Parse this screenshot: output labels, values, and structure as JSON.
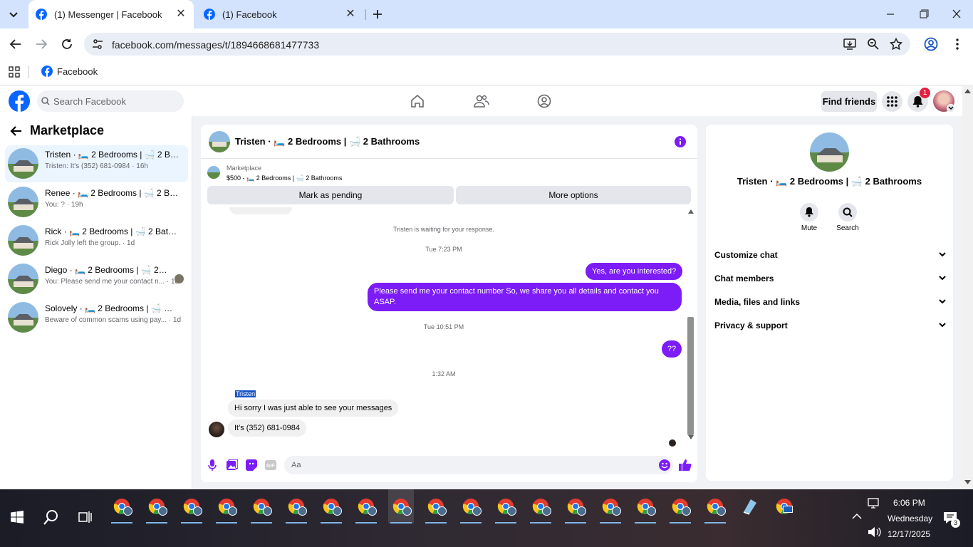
{
  "browser": {
    "tabs": [
      {
        "title": "(1) Messenger | Facebook",
        "active": true
      },
      {
        "title": "(1) Facebook",
        "active": false
      }
    ],
    "url": "facebook.com/messages/t/1894668681477733",
    "bookmark": "Facebook"
  },
  "header": {
    "search_placeholder": "Search Facebook",
    "find_friends": "Find friends",
    "notification_count": "1"
  },
  "sidebar": {
    "title": "Marketplace",
    "conversations": [
      {
        "name": "Tristen · 🛏️ 2 Bedrooms | 🛁 2 Bat...",
        "preview": "Tristen: It's (352) 681-0984 · 16h",
        "selected": true
      },
      {
        "name": "Renee · 🛏️ 2 Bedrooms | 🛁 2 Bath...",
        "preview": "You: ? · 19h"
      },
      {
        "name": "Rick · 🛏️ 2 Bedrooms | 🛁 2 Bathr...",
        "preview": "Rick Jolly left the group. · 1d"
      },
      {
        "name": "Diego · 🛏️ 2 Bedrooms | 🛁 2 B...",
        "preview": "You: Please send me your contact n... · 1d"
      },
      {
        "name": "Solovely · 🛏️ 2 Bedrooms | 🛁 2 B...",
        "preview": "Beware of common scams using pay...   · 1d"
      }
    ]
  },
  "chat": {
    "title": "Tristen · 🛏️ 2 Bedrooms | 🛁 2 Bathrooms",
    "listing_label": "Marketplace",
    "listing_detail": "$500 - 🛏️ 2 Bedrooms | 🛁 2 Bathrooms",
    "mark_pending": "Mark as pending",
    "more_options": "More options",
    "waiting": "Tristen is waiting for your response.",
    "ts1": "Tue 7:23 PM",
    "msg1": "Yes, are you interested?",
    "msg2": "Please send me your contact number So, we share you all details and contact you ASAP.",
    "ts2": "Tue 10:51 PM",
    "msg3": "??",
    "ts3": "1:32 AM",
    "sender": "Tristen",
    "msg4": "Hi sorry I was just able to see your messages",
    "msg5": "It's (352) 681-0984",
    "composer_placeholder": "Aa"
  },
  "details": {
    "name": "Tristen · 🛏️ 2 Bedrooms | 🛁 2 Bathrooms",
    "mute": "Mute",
    "search": "Search",
    "sections": [
      "Customize chat",
      "Chat members",
      "Media, files and links",
      "Privacy & support"
    ]
  },
  "taskbar": {
    "time": "6:06 PM",
    "day": "Wednesday",
    "date": "12/17/2025",
    "notif_count": "3"
  },
  "colors": {
    "accent": "#7c1cf6",
    "facebook_blue": "#0866ff"
  }
}
